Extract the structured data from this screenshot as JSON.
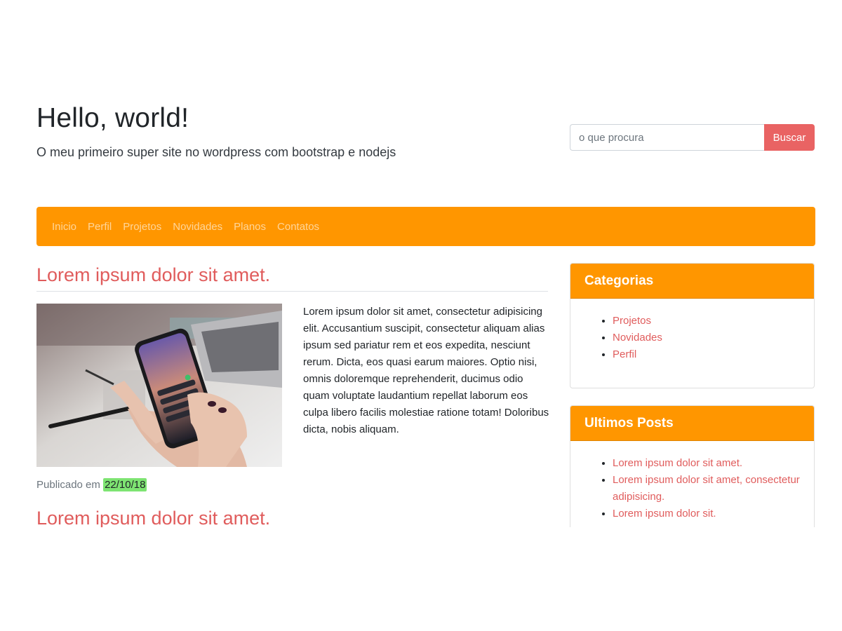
{
  "header": {
    "title": "Hello, world!",
    "description": "O meu primeiro super site no wordpress com bootstrap e nodejs"
  },
  "search": {
    "placeholder": "o que procura",
    "button_label": "Buscar"
  },
  "nav": {
    "items": [
      "Inicio",
      "Perfil",
      "Projetos",
      "Novidades",
      "Planos",
      "Contatos"
    ]
  },
  "posts": [
    {
      "title": "Lorem ipsum dolor sit amet.",
      "excerpt": "Lorem ipsum dolor sit amet, consectetur adipisicing elit. Accusantium suscipit, consectetur aliquam alias ipsum sed pariatur rem et eos expedita, nesciunt rerum. Dicta, eos quasi earum maiores. Optio nisi, omnis doloremque reprehenderit, ducimus odio quam voluptate laudantium repellat laborum eos culpa libero facilis molestiae ratione totam! Doloribus dicta, nobis aliquam.",
      "meta_label": "Publicado em",
      "date": "22/10/18"
    },
    {
      "title": "Lorem ipsum dolor sit amet."
    }
  ],
  "sidebar": {
    "categories": {
      "title": "Categorias",
      "items": [
        "Projetos",
        "Novidades",
        "Perfil"
      ]
    },
    "recent": {
      "title": "Ultimos Posts",
      "items": [
        "Lorem ipsum dolor sit amet.",
        "Lorem ipsum dolor sit amet, consectetur adipisicing.",
        "Lorem ipsum dolor sit."
      ]
    }
  },
  "colors": {
    "primary_orange": "#ff9600",
    "accent_red": "#e96363",
    "date_highlight": "#7ee472"
  }
}
